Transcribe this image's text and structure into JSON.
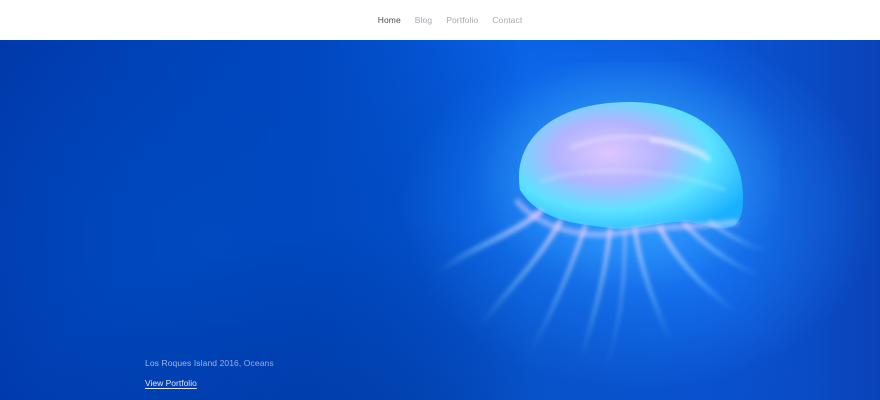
{
  "nav": {
    "items": [
      {
        "label": "Home",
        "active": true
      },
      {
        "label": "Blog",
        "active": false
      },
      {
        "label": "Portfolio",
        "active": false
      },
      {
        "label": "Contact",
        "active": false
      }
    ]
  },
  "hero": {
    "caption": "Los Roques Island 2016, Oceans",
    "link_label": "View Portfolio",
    "image_subject": "jellyfish"
  },
  "colors": {
    "nav_active": "#4b4d57",
    "nav_inactive": "#a8aab4",
    "hero_deep_blue": "#0036a6",
    "hero_bright_blue": "#1f86ff",
    "jelly_cyan": "#5fe6ff",
    "jelly_pink": "#f0b8f0"
  }
}
